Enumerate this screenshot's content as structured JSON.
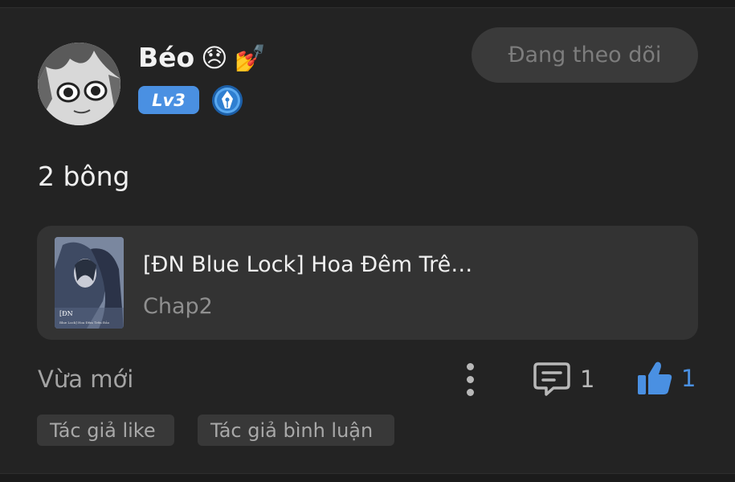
{
  "user": {
    "name": "Béo",
    "emoji_1": "😞",
    "emoji_2": "💅",
    "level": "Lv3",
    "follow_label": "Đang theo dõi"
  },
  "post": {
    "text": "2 bông",
    "time": "Vừa mới",
    "comment_count": "1",
    "like_count": "1"
  },
  "story": {
    "title": "[ĐN Blue Lock] Hoa Đêm Trê…",
    "chapter": "Chap2",
    "cover_text_1": "[ĐN",
    "cover_text_2": "Blue Lock] Hoa Đêm Trên Đảo"
  },
  "tags": [
    "Tác giả like",
    "Tác giả bình luận"
  ],
  "icons": {
    "more": "more-vertical-icon",
    "comment": "comment-icon",
    "like": "thumbs-up-icon",
    "badge": "pen-nib-icon"
  },
  "colors": {
    "background": "#232323",
    "accent": "#4a90e2",
    "card": "#333333",
    "follow_bg": "#3a3a3a"
  }
}
